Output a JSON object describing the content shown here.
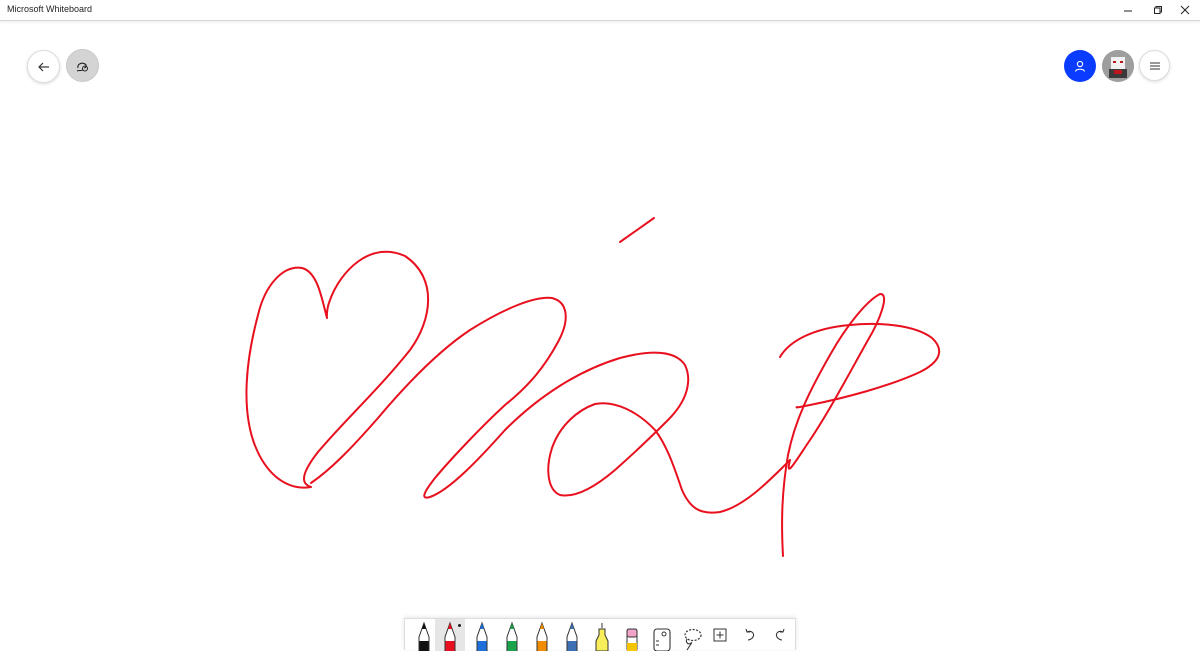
{
  "window": {
    "title": "Microsoft Whiteboard",
    "controls": [
      "minimize-icon",
      "restore-icon",
      "close-icon"
    ]
  },
  "top_left": [
    {
      "name": "back-button",
      "icon": "arrow-left-icon"
    },
    {
      "name": "ink-beautify-button",
      "icon": "ink-beautify-icon",
      "state": "active"
    }
  ],
  "top_right": [
    {
      "name": "invite-button",
      "icon": "person-icon",
      "color": "#0a3cff"
    },
    {
      "name": "avatar",
      "icon": "user-avatar"
    },
    {
      "name": "settings-menu-button",
      "icon": "hamburger-menu-icon"
    }
  ],
  "canvas": {
    "ink_color": "#e8101e",
    "ink_description": "handwritten red ink strokes"
  },
  "toolbar": {
    "tools": [
      {
        "name": "pen-black",
        "icon": "pen-icon",
        "color": "#111111"
      },
      {
        "name": "pen-red",
        "icon": "pen-icon",
        "color": "#e8101e",
        "selected": true
      },
      {
        "name": "pen-blue",
        "icon": "pen-icon",
        "color": "#1e6fd9"
      },
      {
        "name": "pen-green",
        "icon": "pen-icon",
        "color": "#1aa34a"
      },
      {
        "name": "pen-rainbow",
        "icon": "pen-icon",
        "color": "#f08c00"
      },
      {
        "name": "pen-galaxy",
        "icon": "pen-icon",
        "color": "#3d6fb5"
      },
      {
        "name": "highlighter",
        "icon": "highlighter-icon",
        "color": "#f7ee5a"
      },
      {
        "name": "eraser",
        "icon": "eraser-icon",
        "color": "#f2a3c8"
      },
      {
        "name": "ruler",
        "icon": "ruler-icon",
        "color": "#333333"
      },
      {
        "name": "lasso",
        "icon": "lasso-icon",
        "color": "#333333"
      },
      {
        "name": "add",
        "icon": "plus-box-icon",
        "color": "#333333"
      },
      {
        "name": "undo",
        "icon": "undo-icon",
        "color": "#333333"
      },
      {
        "name": "redo",
        "icon": "redo-icon",
        "color": "#333333"
      }
    ]
  }
}
